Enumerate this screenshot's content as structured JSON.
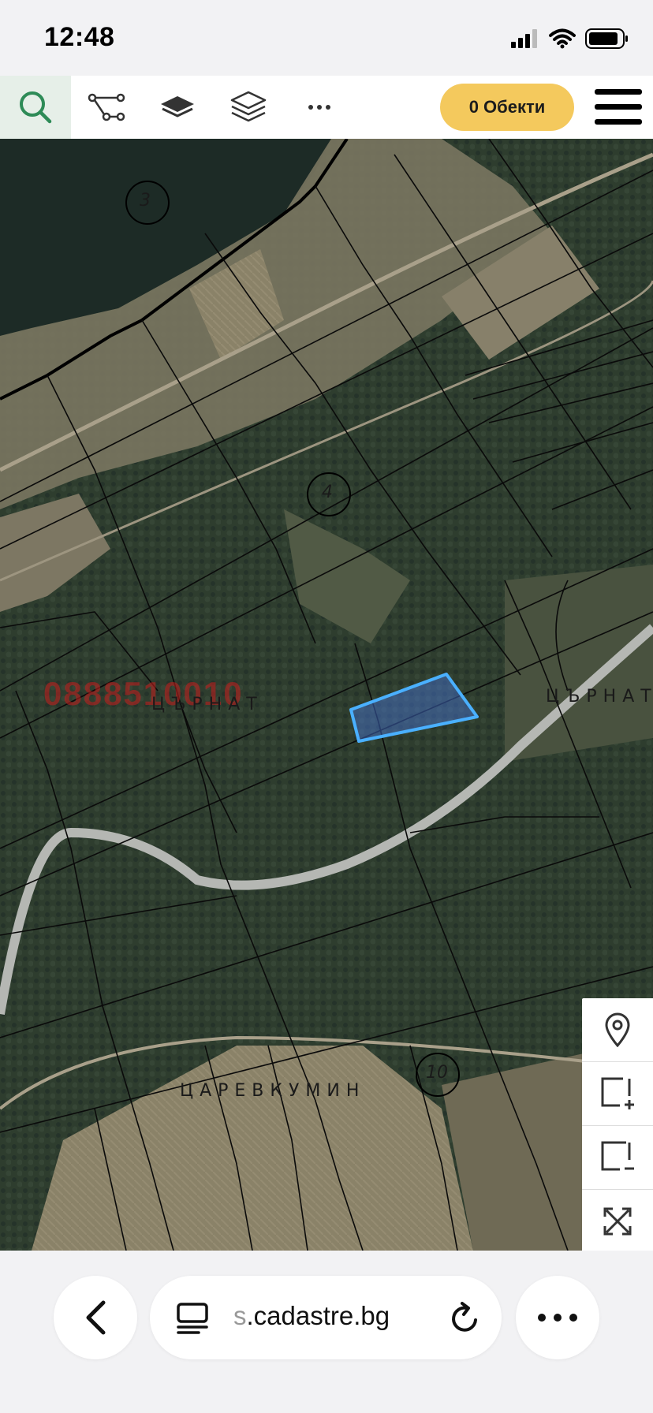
{
  "status_bar": {
    "time": "12:48"
  },
  "toolbar": {
    "tools": [
      "search-icon",
      "route-icon",
      "layer-icon",
      "layers-icon",
      "more-icon"
    ],
    "objects_button": "0 Обекти",
    "accent_color": "#2e8b57",
    "button_color": "#f4c95d"
  },
  "map": {
    "locality_labels": [
      "ЦЪРНАТ",
      "ЦЪРНАТ",
      "ЦАРЕВКУМИН"
    ],
    "block_numbers": [
      "3",
      "4",
      "10"
    ],
    "watermark": "0888510010",
    "selected_parcel_color": "#4ab0ff",
    "controls": [
      "location-pin-icon",
      "zoom-in-box-icon",
      "zoom-out-box-icon",
      "fit-extent-icon"
    ]
  },
  "browser": {
    "url_prefix": "s",
    "url_domain": ".cadastre.bg",
    "buttons": [
      "back-chevron-icon",
      "tab-list-icon",
      "reload-icon",
      "more-dots-icon"
    ]
  }
}
